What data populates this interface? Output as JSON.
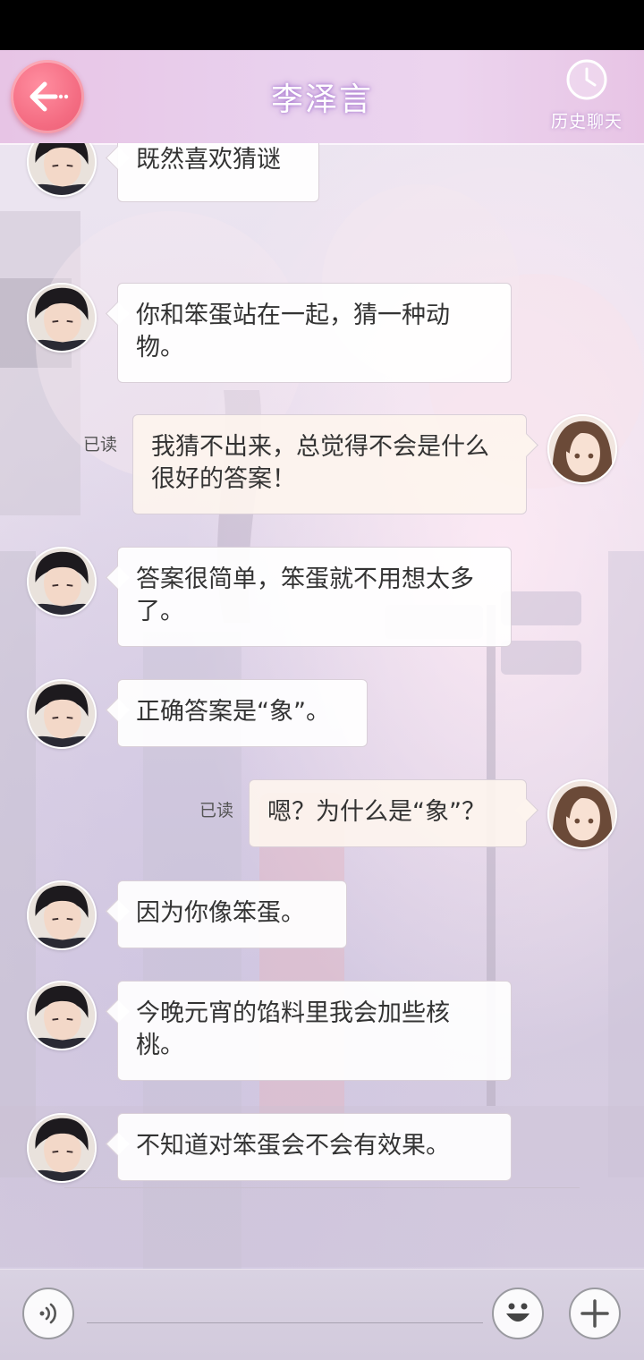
{
  "header": {
    "title": "李泽言",
    "history_label": "历史聊天"
  },
  "icons": {
    "back": "back-arrow-icon",
    "history": "clock-icon",
    "voice": "voice-icon",
    "emoji": "emoji-icon",
    "plus": "plus-icon"
  },
  "colors": {
    "accent_back_button": "#f46c82",
    "incoming_bubble": "#ffffff",
    "outgoing_bubble": "#fdf4ee",
    "header": "#e9d1ee"
  },
  "chat": {
    "messages": [
      {
        "sender": "李泽言",
        "direction": "in",
        "text": "既然喜欢猜谜"
      },
      {
        "sender": "李泽言",
        "direction": "in",
        "text": "你和笨蛋站在一起，猜一种动物。"
      },
      {
        "sender": "me",
        "direction": "out",
        "text": "我猜不出来，总觉得不会是什么很好的答案！",
        "status": "已读"
      },
      {
        "sender": "李泽言",
        "direction": "in",
        "text": "答案很简单，笨蛋就不用想太多了。"
      },
      {
        "sender": "李泽言",
        "direction": "in",
        "text": "正确答案是“象”。"
      },
      {
        "sender": "me",
        "direction": "out",
        "text": "嗯？为什么是“象”？",
        "status": "已读"
      },
      {
        "sender": "李泽言",
        "direction": "in",
        "text": "因为你像笨蛋。"
      },
      {
        "sender": "李泽言",
        "direction": "in",
        "text": "今晚元宵的馅料里我会加些核桃。"
      },
      {
        "sender": "李泽言",
        "direction": "in",
        "text": "不知道对笨蛋会不会有效果。"
      }
    ]
  },
  "input": {
    "value": "",
    "placeholder": ""
  }
}
